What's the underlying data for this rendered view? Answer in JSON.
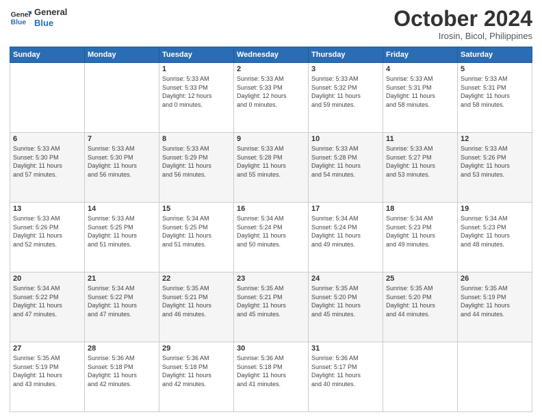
{
  "header": {
    "logo_line1": "General",
    "logo_line2": "Blue",
    "month": "October 2024",
    "location": "Irosin, Bicol, Philippines"
  },
  "weekdays": [
    "Sunday",
    "Monday",
    "Tuesday",
    "Wednesday",
    "Thursday",
    "Friday",
    "Saturday"
  ],
  "weeks": [
    [
      {
        "day": "",
        "detail": ""
      },
      {
        "day": "",
        "detail": ""
      },
      {
        "day": "1",
        "detail": "Sunrise: 5:33 AM\nSunset: 5:33 PM\nDaylight: 12 hours\nand 0 minutes."
      },
      {
        "day": "2",
        "detail": "Sunrise: 5:33 AM\nSunset: 5:33 PM\nDaylight: 12 hours\nand 0 minutes."
      },
      {
        "day": "3",
        "detail": "Sunrise: 5:33 AM\nSunset: 5:32 PM\nDaylight: 11 hours\nand 59 minutes."
      },
      {
        "day": "4",
        "detail": "Sunrise: 5:33 AM\nSunset: 5:31 PM\nDaylight: 11 hours\nand 58 minutes."
      },
      {
        "day": "5",
        "detail": "Sunrise: 5:33 AM\nSunset: 5:31 PM\nDaylight: 11 hours\nand 58 minutes."
      }
    ],
    [
      {
        "day": "6",
        "detail": "Sunrise: 5:33 AM\nSunset: 5:30 PM\nDaylight: 11 hours\nand 57 minutes."
      },
      {
        "day": "7",
        "detail": "Sunrise: 5:33 AM\nSunset: 5:30 PM\nDaylight: 11 hours\nand 56 minutes."
      },
      {
        "day": "8",
        "detail": "Sunrise: 5:33 AM\nSunset: 5:29 PM\nDaylight: 11 hours\nand 56 minutes."
      },
      {
        "day": "9",
        "detail": "Sunrise: 5:33 AM\nSunset: 5:28 PM\nDaylight: 11 hours\nand 55 minutes."
      },
      {
        "day": "10",
        "detail": "Sunrise: 5:33 AM\nSunset: 5:28 PM\nDaylight: 11 hours\nand 54 minutes."
      },
      {
        "day": "11",
        "detail": "Sunrise: 5:33 AM\nSunset: 5:27 PM\nDaylight: 11 hours\nand 53 minutes."
      },
      {
        "day": "12",
        "detail": "Sunrise: 5:33 AM\nSunset: 5:26 PM\nDaylight: 11 hours\nand 53 minutes."
      }
    ],
    [
      {
        "day": "13",
        "detail": "Sunrise: 5:33 AM\nSunset: 5:26 PM\nDaylight: 11 hours\nand 52 minutes."
      },
      {
        "day": "14",
        "detail": "Sunrise: 5:33 AM\nSunset: 5:25 PM\nDaylight: 11 hours\nand 51 minutes."
      },
      {
        "day": "15",
        "detail": "Sunrise: 5:34 AM\nSunset: 5:25 PM\nDaylight: 11 hours\nand 51 minutes."
      },
      {
        "day": "16",
        "detail": "Sunrise: 5:34 AM\nSunset: 5:24 PM\nDaylight: 11 hours\nand 50 minutes."
      },
      {
        "day": "17",
        "detail": "Sunrise: 5:34 AM\nSunset: 5:24 PM\nDaylight: 11 hours\nand 49 minutes."
      },
      {
        "day": "18",
        "detail": "Sunrise: 5:34 AM\nSunset: 5:23 PM\nDaylight: 11 hours\nand 49 minutes."
      },
      {
        "day": "19",
        "detail": "Sunrise: 5:34 AM\nSunset: 5:23 PM\nDaylight: 11 hours\nand 48 minutes."
      }
    ],
    [
      {
        "day": "20",
        "detail": "Sunrise: 5:34 AM\nSunset: 5:22 PM\nDaylight: 11 hours\nand 47 minutes."
      },
      {
        "day": "21",
        "detail": "Sunrise: 5:34 AM\nSunset: 5:22 PM\nDaylight: 11 hours\nand 47 minutes."
      },
      {
        "day": "22",
        "detail": "Sunrise: 5:35 AM\nSunset: 5:21 PM\nDaylight: 11 hours\nand 46 minutes."
      },
      {
        "day": "23",
        "detail": "Sunrise: 5:35 AM\nSunset: 5:21 PM\nDaylight: 11 hours\nand 45 minutes."
      },
      {
        "day": "24",
        "detail": "Sunrise: 5:35 AM\nSunset: 5:20 PM\nDaylight: 11 hours\nand 45 minutes."
      },
      {
        "day": "25",
        "detail": "Sunrise: 5:35 AM\nSunset: 5:20 PM\nDaylight: 11 hours\nand 44 minutes."
      },
      {
        "day": "26",
        "detail": "Sunrise: 5:35 AM\nSunset: 5:19 PM\nDaylight: 11 hours\nand 44 minutes."
      }
    ],
    [
      {
        "day": "27",
        "detail": "Sunrise: 5:35 AM\nSunset: 5:19 PM\nDaylight: 11 hours\nand 43 minutes."
      },
      {
        "day": "28",
        "detail": "Sunrise: 5:36 AM\nSunset: 5:18 PM\nDaylight: 11 hours\nand 42 minutes."
      },
      {
        "day": "29",
        "detail": "Sunrise: 5:36 AM\nSunset: 5:18 PM\nDaylight: 11 hours\nand 42 minutes."
      },
      {
        "day": "30",
        "detail": "Sunrise: 5:36 AM\nSunset: 5:18 PM\nDaylight: 11 hours\nand 41 minutes."
      },
      {
        "day": "31",
        "detail": "Sunrise: 5:36 AM\nSunset: 5:17 PM\nDaylight: 11 hours\nand 40 minutes."
      },
      {
        "day": "",
        "detail": ""
      },
      {
        "day": "",
        "detail": ""
      }
    ]
  ]
}
